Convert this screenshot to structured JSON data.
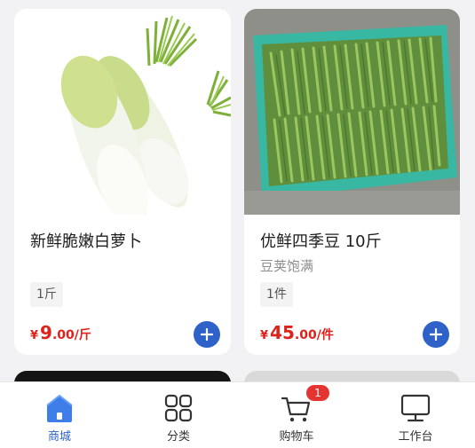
{
  "products": [
    {
      "name": "新鲜脆嫩白萝卜",
      "subtitle": "",
      "spec": "1斤",
      "price_currency": "¥",
      "price_int": "9",
      "price_dec": ".00",
      "price_unit": "/斤"
    },
    {
      "name": "优鲜四季豆 10斤",
      "subtitle": "豆荚饱满",
      "spec": "1件",
      "price_currency": "¥",
      "price_int": "45",
      "price_dec": ".00",
      "price_unit": "/件"
    }
  ],
  "tabbar": {
    "items": [
      {
        "label": "商城",
        "icon": "home-icon"
      },
      {
        "label": "分类",
        "icon": "grid-icon"
      },
      {
        "label": "购物车",
        "icon": "cart-icon"
      },
      {
        "label": "工作台",
        "icon": "monitor-icon"
      }
    ],
    "cart_badge": "1"
  },
  "colors": {
    "accent": "#2e62c9",
    "price": "#e0201a",
    "badge": "#e53330"
  }
}
